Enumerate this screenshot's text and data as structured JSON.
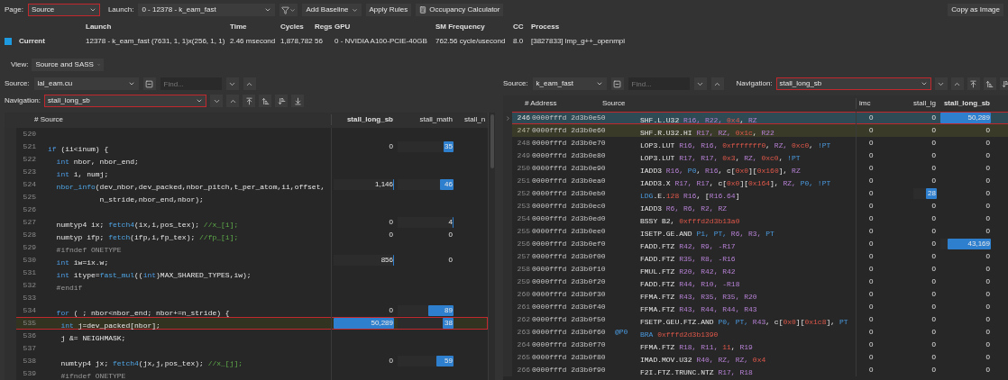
{
  "toolbar": {
    "page": {
      "label": "Page:",
      "value": "Source",
      "outlined": true
    },
    "launch": {
      "label": "Launch:",
      "value": "0 - 12378 - k_eam_fast"
    },
    "buttons": [
      "Add Baseline",
      "Apply Rules",
      "Occupancy Calculator"
    ],
    "copy": "Copy as Image"
  },
  "info": {
    "columns": [
      "Launch",
      "Time",
      "Cycles",
      "Regs",
      "GPU",
      "SM Frequency",
      "CC",
      "Process"
    ],
    "rows": [
      {
        "name": "Current",
        "color": "#1e9be0",
        "values": [
          "12378 - k_eam_fast (7631, 1, 1)x(256, 1, 1)",
          "2.46 msecond",
          "1,878,782",
          "56",
          "0 - NVIDIA A100-PCIE-40GB",
          "762.56 cycle/usecond",
          "8.0",
          "[3827833] lmp_g++_openmpi"
        ]
      }
    ]
  },
  "view": {
    "label": "View:",
    "value": "Source and SASS"
  },
  "source_panel": {
    "source_label": "Source:",
    "source": "lal_eam.cu",
    "find_placeholder": "Find...",
    "nav_label": "Navigation:",
    "nav": "stall_long_sb",
    "nav_outlined": true,
    "columns": [
      "# Source",
      "stall_long_sb",
      "stall_math",
      "stall_n"
    ],
    "rows": [
      {
        "line": "520",
        "highlighted": false,
        "outlined": false,
        "code": [],
        "m1": null,
        "m2": null
      },
      {
        "line": "521",
        "highlighted": false,
        "outlined": false,
        "code": [
          {
            "kind": "kw",
            "text": "if"
          },
          {
            "kind": "plain",
            "text": " (ii<inum) {"
          }
        ],
        "m1": {
          "text": "0"
        },
        "m2": {
          "text": "35",
          "level": 0.17
        }
      },
      {
        "line": "522",
        "highlighted": false,
        "outlined": false,
        "code": [
          {
            "kind": "kw",
            "text": "  int"
          },
          {
            "kind": "plain",
            "text": " nbor, nbor_end;"
          }
        ],
        "m1": null,
        "m2": null
      },
      {
        "line": "523",
        "highlighted": false,
        "outlined": false,
        "code": [
          {
            "kind": "kw",
            "text": "  int"
          },
          {
            "kind": "plain",
            "text": " i, numj;"
          }
        ],
        "m1": null,
        "m2": null
      },
      {
        "line": "524",
        "highlighted": false,
        "outlined": false,
        "code": [
          {
            "kind": "fn",
            "text": "  nbor_info"
          },
          {
            "kind": "plain",
            "text": "(dev_nbor,dev_packed,nbor_pitch,t_per_atom,ii,offset,"
          }
        ],
        "m1": {
          "text": "1,146",
          "level": 0.02
        },
        "m2": {
          "text": "46",
          "level": 0.24
        }
      },
      {
        "line": "525",
        "highlighted": false,
        "outlined": false,
        "code": [
          {
            "kind": "plain",
            "text": "            n_stride,nbor_end,nbor);"
          }
        ],
        "m1": null,
        "m2": null
      },
      {
        "line": "526",
        "highlighted": false,
        "outlined": false,
        "code": [],
        "m1": null,
        "m2": null
      },
      {
        "line": "527",
        "highlighted": false,
        "outlined": false,
        "code": [
          {
            "kind": "plain",
            "text": "  numtyp4 ix; "
          },
          {
            "kind": "fn",
            "text": "fetch4"
          },
          {
            "kind": "plain",
            "text": "(ix,i,pos_tex); "
          },
          {
            "kind": "comment",
            "text": "//x_[i];"
          }
        ],
        "m1": {
          "text": "0"
        },
        "m2": {
          "text": "4",
          "level": 0.02
        }
      },
      {
        "line": "528",
        "highlighted": false,
        "outlined": false,
        "code": [
          {
            "kind": "plain",
            "text": "  numtyp ifp; "
          },
          {
            "kind": "fn",
            "text": "fetch"
          },
          {
            "kind": "plain",
            "text": "(ifp,i,fp_tex); "
          },
          {
            "kind": "comment",
            "text": "//fp_[i];"
          }
        ],
        "m1": {
          "text": "0"
        },
        "m2": {
          "text": "0"
        }
      },
      {
        "line": "529",
        "highlighted": false,
        "outlined": false,
        "code": [
          {
            "kind": "pre",
            "text": "  #ifndef ONETYPE"
          }
        ],
        "m1": null,
        "m2": null
      },
      {
        "line": "530",
        "highlighted": false,
        "outlined": false,
        "code": [
          {
            "kind": "kw",
            "text": "  int"
          },
          {
            "kind": "plain",
            "text": " iw=ix.w;"
          }
        ],
        "m1": {
          "text": "856",
          "level": 0.02
        },
        "m2": {
          "text": "0"
        }
      },
      {
        "line": "531",
        "highlighted": false,
        "outlined": false,
        "code": [
          {
            "kind": "kw",
            "text": "  int"
          },
          {
            "kind": "plain",
            "text": " itype="
          },
          {
            "kind": "fn",
            "text": "fast_mul"
          },
          {
            "kind": "plain",
            "text": "(("
          },
          {
            "kind": "kw",
            "text": "int"
          },
          {
            "kind": "plain",
            "text": ")MAX_SHARED_TYPES,iw);"
          }
        ],
        "m1": null,
        "m2": null
      },
      {
        "line": "532",
        "highlighted": false,
        "outlined": false,
        "code": [
          {
            "kind": "pre",
            "text": "  #endif"
          }
        ],
        "m1": null,
        "m2": null
      },
      {
        "line": "533",
        "highlighted": false,
        "outlined": false,
        "code": [],
        "m1": null,
        "m2": null
      },
      {
        "line": "534",
        "highlighted": false,
        "outlined": false,
        "code": [
          {
            "kind": "kw",
            "text": "  for"
          },
          {
            "kind": "plain",
            "text": " ( ; nbor<nbor_end; nbor+=n_stride) {"
          }
        ],
        "m1": {
          "text": "0"
        },
        "m2": {
          "text": "89",
          "level": 0.45
        }
      },
      {
        "line": "535",
        "highlighted": true,
        "outlined": true,
        "code": [
          {
            "kind": "kw",
            "text": "   int"
          },
          {
            "kind": "plain",
            "text": " j=dev_packed[nbor];"
          }
        ],
        "m1": {
          "text": "50,289",
          "level": 1
        },
        "m2": {
          "text": "38",
          "level": 0.19
        }
      },
      {
        "line": "536",
        "highlighted": false,
        "outlined": false,
        "code": [
          {
            "kind": "plain",
            "text": "   j &= NEIGHMASK;"
          }
        ],
        "m1": null,
        "m2": null
      },
      {
        "line": "537",
        "highlighted": false,
        "outlined": false,
        "code": [],
        "m1": null,
        "m2": null
      },
      {
        "line": "538",
        "highlighted": false,
        "outlined": false,
        "code": [
          {
            "kind": "plain",
            "text": "   numtyp4 jx; "
          },
          {
            "kind": "fn",
            "text": "fetch4"
          },
          {
            "kind": "plain",
            "text": "(jx,j,pos_tex); "
          },
          {
            "kind": "comment",
            "text": "//x_[j];"
          }
        ],
        "m1": {
          "text": "0"
        },
        "m2": {
          "text": "59",
          "level": 0.3
        }
      },
      {
        "line": "539",
        "highlighted": false,
        "outlined": false,
        "code": [
          {
            "kind": "pre",
            "text": "   #ifndef ONETYPE"
          }
        ],
        "m1": null,
        "m2": null
      }
    ]
  },
  "sass_panel": {
    "source_label": "Source:",
    "source": "k_eam_fast",
    "find_placeholder": "Find...",
    "nav_label": "Navigation:",
    "nav": "stall_long_sb",
    "nav_outlined": true,
    "columns": [
      "# Address",
      "Source",
      "imc",
      "stall_lg",
      "stall_long_sb"
    ],
    "rows": [
      {
        "line": "246",
        "address": "0000fffd 2d3b0e50",
        "selected": true,
        "highlighted": false,
        "outlined": true,
        "code": [
          {
            "kind": "plain",
            "text": "SHF.L.U32 "
          },
          {
            "kind": "reg",
            "text": "R16, R22, "
          },
          {
            "kind": "imm",
            "text": "0x4"
          },
          {
            "kind": "plain",
            "text": ", "
          },
          {
            "kind": "reg",
            "text": "RZ"
          }
        ],
        "imc": "0",
        "lg": {
          "text": "0"
        },
        "lsb": {
          "text": "50,289",
          "level": 1
        }
      },
      {
        "line": "247",
        "address": "0000fffd 2d3b0e60",
        "selected": false,
        "highlighted": true,
        "outlined": false,
        "code": [
          {
            "kind": "plain",
            "text": "SHF.R.U32.HI "
          },
          {
            "kind": "reg",
            "text": "R17, RZ, "
          },
          {
            "kind": "imm",
            "text": "0x1c"
          },
          {
            "kind": "plain",
            "text": ", "
          },
          {
            "kind": "reg",
            "text": "R22"
          }
        ],
        "imc": "0",
        "lg": {
          "text": "0"
        },
        "lsb": {
          "text": "0"
        }
      },
      {
        "line": "248",
        "address": "0000fffd 2d3b0e70",
        "selected": false,
        "highlighted": false,
        "outlined": false,
        "code": [
          {
            "kind": "plain",
            "text": "LOP3.LUT "
          },
          {
            "kind": "reg",
            "text": "R16, R16, "
          },
          {
            "kind": "imm",
            "text": "0xfffffff0"
          },
          {
            "kind": "plain",
            "text": ", "
          },
          {
            "kind": "reg",
            "text": "RZ, "
          },
          {
            "kind": "imm",
            "text": "0xc0"
          },
          {
            "kind": "plain",
            "text": ", "
          },
          {
            "kind": "pred",
            "text": "!PT"
          }
        ],
        "imc": "0",
        "lg": {
          "text": "0"
        },
        "lsb": {
          "text": "0"
        }
      },
      {
        "line": "249",
        "address": "0000fffd 2d3b0e80",
        "selected": false,
        "highlighted": false,
        "outlined": false,
        "code": [
          {
            "kind": "plain",
            "text": "LOP3.LUT "
          },
          {
            "kind": "reg",
            "text": "R17, R17, "
          },
          {
            "kind": "imm",
            "text": "0x3"
          },
          {
            "kind": "plain",
            "text": ", "
          },
          {
            "kind": "reg",
            "text": "RZ, "
          },
          {
            "kind": "imm",
            "text": "0xc0"
          },
          {
            "kind": "plain",
            "text": ", "
          },
          {
            "kind": "pred",
            "text": "!PT"
          }
        ],
        "imc": "0",
        "lg": {
          "text": "0"
        },
        "lsb": {
          "text": "0"
        }
      },
      {
        "line": "250",
        "address": "0000fffd 2d3b0e90",
        "selected": false,
        "highlighted": false,
        "outlined": false,
        "code": [
          {
            "kind": "plain",
            "text": "IADD3 "
          },
          {
            "kind": "reg",
            "text": "R16, "
          },
          {
            "kind": "pred",
            "text": "P0"
          },
          {
            "kind": "plain",
            "text": ", "
          },
          {
            "kind": "reg",
            "text": "R16"
          },
          {
            "kind": "plain",
            "text": ", c["
          },
          {
            "kind": "imm",
            "text": "0x0"
          },
          {
            "kind": "plain",
            "text": "]["
          },
          {
            "kind": "imm",
            "text": "0x160"
          },
          {
            "kind": "plain",
            "text": "], "
          },
          {
            "kind": "reg",
            "text": "RZ"
          }
        ],
        "imc": "0",
        "lg": {
          "text": "0"
        },
        "lsb": {
          "text": "0"
        }
      },
      {
        "line": "251",
        "address": "0000fffd 2d3b0ea0",
        "selected": false,
        "highlighted": false,
        "outlined": false,
        "code": [
          {
            "kind": "plain",
            "text": "IADD3.X "
          },
          {
            "kind": "reg",
            "text": "R17, R17"
          },
          {
            "kind": "plain",
            "text": ", c["
          },
          {
            "kind": "imm",
            "text": "0x0"
          },
          {
            "kind": "plain",
            "text": "]["
          },
          {
            "kind": "imm",
            "text": "0x164"
          },
          {
            "kind": "plain",
            "text": "], "
          },
          {
            "kind": "reg",
            "text": "RZ, "
          },
          {
            "kind": "pred",
            "text": "P0, !PT"
          }
        ],
        "imc": "0",
        "lg": {
          "text": "0"
        },
        "lsb": {
          "text": "0"
        }
      },
      {
        "line": "252",
        "address": "0000fffd 2d3b0eb0",
        "selected": false,
        "highlighted": false,
        "outlined": false,
        "code": [
          {
            "kind": "pred",
            "text": "LDG"
          },
          {
            "kind": "plain",
            "text": ".E."
          },
          {
            "kind": "imm",
            "text": "128"
          },
          {
            "kind": "reg",
            "text": " R16"
          },
          {
            "kind": "plain",
            "text": ", ["
          },
          {
            "kind": "reg",
            "text": "R16.64"
          },
          {
            "kind": "plain",
            "text": "]"
          }
        ],
        "imc": "0",
        "lg": {
          "text": "28",
          "level": 0.45
        },
        "lsb": {
          "text": "0"
        }
      },
      {
        "line": "253",
        "address": "0000fffd 2d3b0ec0",
        "selected": false,
        "highlighted": false,
        "outlined": false,
        "code": [
          {
            "kind": "plain",
            "text": "IADD3 "
          },
          {
            "kind": "reg",
            "text": "R6, R6, R2, RZ"
          }
        ],
        "imc": "0",
        "lg": {
          "text": "0"
        },
        "lsb": {
          "text": "0"
        }
      },
      {
        "line": "254",
        "address": "0000fffd 2d3b0ed0",
        "selected": false,
        "highlighted": false,
        "outlined": false,
        "code": [
          {
            "kind": "plain",
            "text": "BSSY B2, "
          },
          {
            "kind": "imm",
            "text": "0xfffd2d3b13a0"
          }
        ],
        "imc": "0",
        "lg": {
          "text": "0"
        },
        "lsb": {
          "text": "0"
        }
      },
      {
        "line": "255",
        "address": "0000fffd 2d3b0ee0",
        "selected": false,
        "highlighted": false,
        "outlined": false,
        "code": [
          {
            "kind": "plain",
            "text": "ISETP.GE.AND "
          },
          {
            "kind": "pred",
            "text": "P1, PT, "
          },
          {
            "kind": "reg",
            "text": "R6, R3, "
          },
          {
            "kind": "pred",
            "text": "PT"
          }
        ],
        "imc": "0",
        "lg": {
          "text": "0"
        },
        "lsb": {
          "text": "0"
        }
      },
      {
        "line": "256",
        "address": "0000fffd 2d3b0ef0",
        "selected": false,
        "highlighted": false,
        "outlined": false,
        "code": [
          {
            "kind": "plain",
            "text": "FADD.FTZ "
          },
          {
            "kind": "reg",
            "text": "R42, R9, -R17"
          }
        ],
        "imc": "0",
        "lg": {
          "text": "0"
        },
        "lsb": {
          "text": "43,169",
          "level": 0.86
        }
      },
      {
        "line": "257",
        "address": "0000fffd 2d3b0f00",
        "selected": false,
        "highlighted": false,
        "outlined": false,
        "code": [
          {
            "kind": "plain",
            "text": "FADD.FTZ "
          },
          {
            "kind": "reg",
            "text": "R35, R8, -R16"
          }
        ],
        "imc": "0",
        "lg": {
          "text": "0"
        },
        "lsb": {
          "text": "0"
        }
      },
      {
        "line": "258",
        "address": "0000fffd 2d3b0f10",
        "selected": false,
        "highlighted": false,
        "outlined": false,
        "code": [
          {
            "kind": "plain",
            "text": "FMUL.FTZ "
          },
          {
            "kind": "reg",
            "text": "R20, R42, R42"
          }
        ],
        "imc": "0",
        "lg": {
          "text": "0"
        },
        "lsb": {
          "text": "0"
        }
      },
      {
        "line": "259",
        "address": "0000fffd 2d3b0f20",
        "selected": false,
        "highlighted": false,
        "outlined": false,
        "code": [
          {
            "kind": "plain",
            "text": "FADD.FTZ "
          },
          {
            "kind": "reg",
            "text": "R44, R10, -R18"
          }
        ],
        "imc": "0",
        "lg": {
          "text": "0"
        },
        "lsb": {
          "text": "0"
        }
      },
      {
        "line": "260",
        "address": "0000fffd 2d3b0f30",
        "selected": false,
        "highlighted": false,
        "outlined": false,
        "code": [
          {
            "kind": "plain",
            "text": "FFMA.FTZ "
          },
          {
            "kind": "reg",
            "text": "R43, R35, R35, R20"
          }
        ],
        "imc": "0",
        "lg": {
          "text": "0"
        },
        "lsb": {
          "text": "0"
        }
      },
      {
        "line": "261",
        "address": "0000fffd 2d3b0f40",
        "selected": false,
        "highlighted": false,
        "outlined": false,
        "code": [
          {
            "kind": "plain",
            "text": "FFMA.FTZ "
          },
          {
            "kind": "reg",
            "text": "R43, R44, R44, R43"
          }
        ],
        "imc": "0",
        "lg": {
          "text": "0"
        },
        "lsb": {
          "text": "0"
        }
      },
      {
        "line": "262",
        "address": "0000fffd 2d3b0f50",
        "selected": false,
        "highlighted": false,
        "outlined": false,
        "code": [
          {
            "kind": "plain",
            "text": "FSETP.GEU.FTZ.AND "
          },
          {
            "kind": "pred",
            "text": "P0, PT, "
          },
          {
            "kind": "reg",
            "text": "R43"
          },
          {
            "kind": "plain",
            "text": ", c["
          },
          {
            "kind": "imm",
            "text": "0x0"
          },
          {
            "kind": "plain",
            "text": "]["
          },
          {
            "kind": "imm",
            "text": "0x1c8"
          },
          {
            "kind": "plain",
            "text": "], "
          },
          {
            "kind": "pred",
            "text": "PT"
          }
        ],
        "imc": "0",
        "lg": {
          "text": "0"
        },
        "lsb": {
          "text": "0"
        }
      },
      {
        "line": "263",
        "address": "0000fffd 2d3b0f60",
        "predicate": "@P0",
        "selected": false,
        "highlighted": false,
        "outlined": false,
        "code": [
          {
            "kind": "pred",
            "text": "BRA "
          },
          {
            "kind": "imm",
            "text": "0xfffd2d3b1390"
          }
        ],
        "imc": "0",
        "lg": {
          "text": "0"
        },
        "lsb": {
          "text": "0"
        }
      },
      {
        "line": "264",
        "address": "0000fffd 2d3b0f70",
        "selected": false,
        "highlighted": false,
        "outlined": false,
        "code": [
          {
            "kind": "plain",
            "text": "FFMA.FTZ "
          },
          {
            "kind": "reg",
            "text": "R18, R11, "
          },
          {
            "kind": "imm",
            "text": "11"
          },
          {
            "kind": "plain",
            "text": ", "
          },
          {
            "kind": "reg",
            "text": "R19"
          }
        ],
        "imc": "0",
        "lg": {
          "text": "0"
        },
        "lsb": {
          "text": "0"
        }
      },
      {
        "line": "265",
        "address": "0000fffd 2d3b0f80",
        "selected": false,
        "highlighted": false,
        "outlined": false,
        "code": [
          {
            "kind": "plain",
            "text": "IMAD.MOV.U32 "
          },
          {
            "kind": "reg",
            "text": "R40, RZ, RZ, "
          },
          {
            "kind": "imm",
            "text": "0x4"
          }
        ],
        "imc": "0",
        "lg": {
          "text": "0"
        },
        "lsb": {
          "text": "0"
        }
      },
      {
        "line": "266",
        "address": "0000fffd 2d3b0f90",
        "selected": false,
        "highlighted": false,
        "outlined": false,
        "code": [
          {
            "kind": "plain",
            "text": "F2I.FTZ.TRUNC.NTZ "
          },
          {
            "kind": "reg",
            "text": "R17, R18"
          }
        ],
        "imc": "0",
        "lg": {
          "text": "0"
        },
        "lsb": {
          "text": "0"
        }
      }
    ]
  }
}
